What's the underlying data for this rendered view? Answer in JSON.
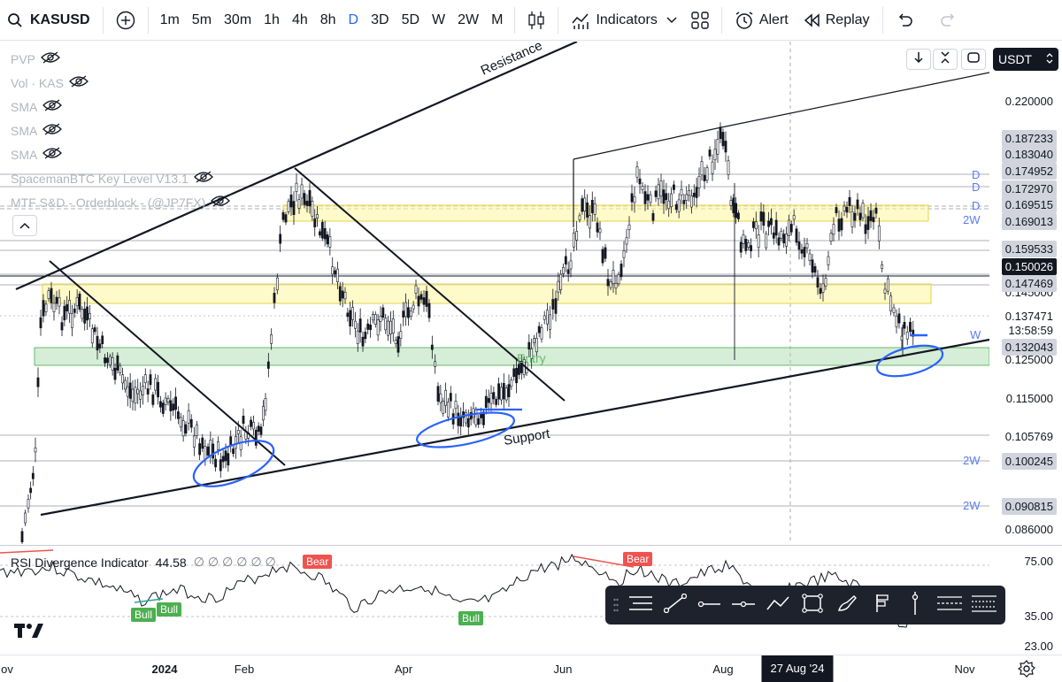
{
  "toolbar": {
    "symbol": "KASUSD",
    "intervals": [
      "1m",
      "5m",
      "30m",
      "1h",
      "4h",
      "8h",
      "D",
      "3D",
      "5D",
      "W",
      "2W",
      "M"
    ],
    "active_interval": "D",
    "indicators_label": "Indicators",
    "alert_label": "Alert",
    "replay_label": "Replay"
  },
  "legend": {
    "items": [
      "PVP",
      "Vol · KAS",
      "SMA",
      "SMA",
      "SMA",
      "SpacemanBTC Key Level V13.1",
      "MTF S&D - Orderblock - (@JP7FX)"
    ]
  },
  "currency": "USDT",
  "price_scale": {
    "labels": [
      "0.220000",
      "0.145000",
      "0.115000",
      "0.086000"
    ],
    "badges": [
      {
        "value": "0.187233",
        "style": "grey"
      },
      {
        "value": "0.183040",
        "style": "grey"
      },
      {
        "value": "0.174952",
        "style": "grey"
      },
      {
        "value": "0.172970",
        "style": "grey"
      },
      {
        "value": "0.169515",
        "style": "grey"
      },
      {
        "value": "0.169013",
        "style": "grey"
      },
      {
        "value": "0.159533",
        "style": "grey"
      },
      {
        "value": "0.150026",
        "style": "dark"
      },
      {
        "value": "0.147469",
        "style": "grey"
      },
      {
        "value": "0.137471",
        "style": "white"
      },
      {
        "value": "13:58:59",
        "style": "white"
      },
      {
        "value": "0.132043",
        "style": "grey"
      },
      {
        "value": "0.125000",
        "style": "plain"
      },
      {
        "value": "0.105769",
        "style": "white"
      },
      {
        "value": "0.100245",
        "style": "grey"
      },
      {
        "value": "0.090815",
        "style": "grey"
      }
    ],
    "level_tags": [
      "D",
      "D",
      "D",
      "2W",
      "W",
      "2W",
      "2W"
    ]
  },
  "annotations": {
    "resistance": "Resistance",
    "support": "Support",
    "entry": "Entry"
  },
  "rsi": {
    "title": "RSI Divergence Indicator",
    "value": "44.58",
    "scale": [
      "75.00",
      "35.00",
      "23.00"
    ],
    "bear_label": "Bear",
    "bull_label": "Bull"
  },
  "time_axis": {
    "labels": [
      "ov",
      "2024",
      "Feb",
      "Apr",
      "Jun",
      "Aug",
      "Nov"
    ],
    "crosshair": "27 Aug '24"
  },
  "logo": "TV"
}
